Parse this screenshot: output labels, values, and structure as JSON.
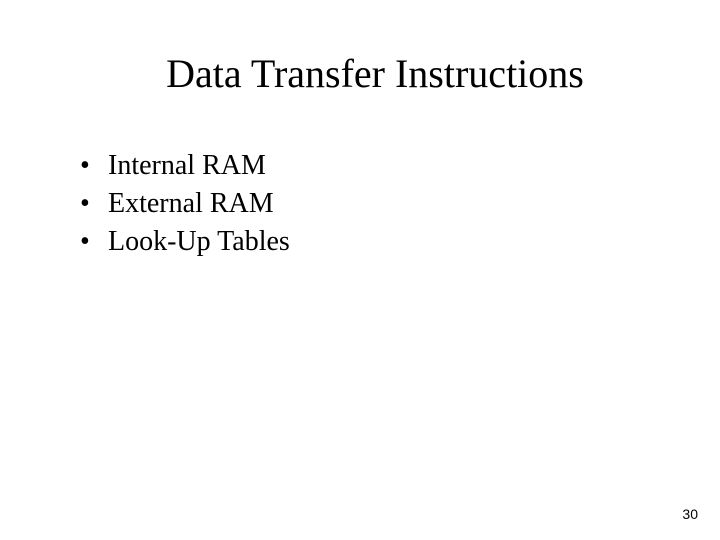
{
  "title": "Data Transfer Instructions",
  "bullets": {
    "item0": "Internal RAM",
    "item1": "External RAM",
    "item2": "Look-Up Tables"
  },
  "page_number": "30"
}
